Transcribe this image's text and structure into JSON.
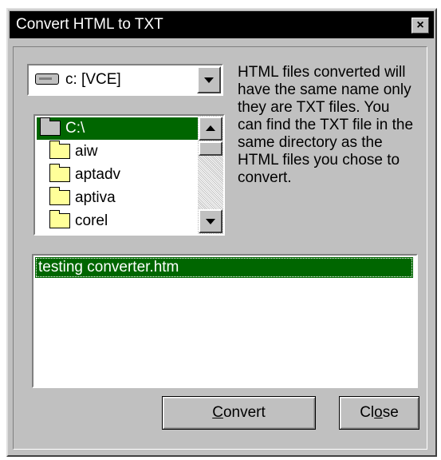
{
  "window": {
    "title": "Convert HTML to TXT",
    "close_glyph": "×"
  },
  "drive_combo": {
    "value": "c: [VCE]"
  },
  "directories": {
    "items": [
      {
        "label": "C:\\",
        "selected": true,
        "open": true
      },
      {
        "label": "aiw",
        "selected": false
      },
      {
        "label": "aptadv",
        "selected": false
      },
      {
        "label": "aptiva",
        "selected": false
      },
      {
        "label": "corel",
        "selected": false
      }
    ]
  },
  "info_text": "HTML files converted will have the same name only they are TXT files.  You can find the TXT file in the same directory as the HTML files you chose to convert.",
  "file_list": {
    "items": [
      "testing converter.htm"
    ]
  },
  "buttons": {
    "convert_mnemonic": "C",
    "convert_rest": "onvert",
    "close_pre": "Cl",
    "close_mnemonic": "o",
    "close_rest": "se"
  },
  "colors": {
    "selection": "#006600",
    "face": "#c0c0c0",
    "titlebar": "#000000"
  }
}
